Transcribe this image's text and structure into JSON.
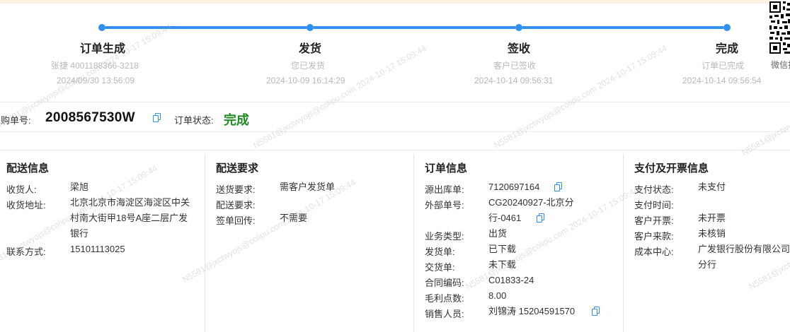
{
  "progress": {
    "steps": [
      {
        "title": "订单生成",
        "line1": "张捷 4001188366-3218",
        "line2": "2024/09/30 13:56:09"
      },
      {
        "title": "发货",
        "line1": "您已发货",
        "line2": "2024-10-09 16:14:29"
      },
      {
        "title": "签收",
        "line1": "客户已签收",
        "line2": "2024-10-14 09:56:31"
      },
      {
        "title": "完成",
        "line1": "订单已完成",
        "line2": "2024-10-14 09:56:54"
      }
    ]
  },
  "qr": {
    "label": "微信扫"
  },
  "order": {
    "po_label": "采购单号:",
    "po_number": "2008567530W",
    "status_label": "订单状态:",
    "status_value": "完成",
    "status_color": "#1f8a24"
  },
  "delivery_info": {
    "title": "配送信息",
    "receiver_label": "收货人:",
    "receiver": "梁旭",
    "address_label": "收货地址:",
    "address": "北京北京市海淀区海淀区中关村南大街甲18号A座二层广发银行",
    "contact_label": "联系方式:",
    "contact": "15101113025"
  },
  "delivery_req": {
    "title": "配送要求",
    "send_label": "送货要求:",
    "send": "需客户发货单",
    "dist_label": "配送要求:",
    "dist": "",
    "sign_label": "签单回传:",
    "sign": "不需要"
  },
  "order_info": {
    "title": "订单信息",
    "source_label": "源出库单:",
    "source": "7120697164",
    "external_label": "外部单号:",
    "external_1": "CG20240927-北京分",
    "external_2": "行-0461",
    "biz_label": "业务类型:",
    "biz": "出货",
    "ship_label": "发货单:",
    "ship": "已下载",
    "deliver_label": "交货单:",
    "deliver": "未下载",
    "contract_label": "合同编码:",
    "contract": "C01833-24",
    "margin_label": "毛利点数:",
    "margin": "8.00",
    "sales_label": "销售人员:",
    "sales": "刘锦涛 15204591570"
  },
  "payment": {
    "title": "支付及开票信息",
    "pay_status_label": "支付状态:",
    "pay_status": "未支付",
    "pay_time_label": "支付时间:",
    "pay_time": "",
    "invoice_label": "客户开票:",
    "invoice": "未开票",
    "receipt_label": "客户来款:",
    "receipt": "未核销",
    "cost_label": "成本中心:",
    "cost_1": "广发银行股份有限公司",
    "cost_2": "分行"
  },
  "watermark": {
    "text": "N5581@jxctwyojs@colipu.com 2024-10-17 15:09:44"
  },
  "colors": {
    "accent": "#2f8ff2",
    "success": "#1f8a24"
  }
}
